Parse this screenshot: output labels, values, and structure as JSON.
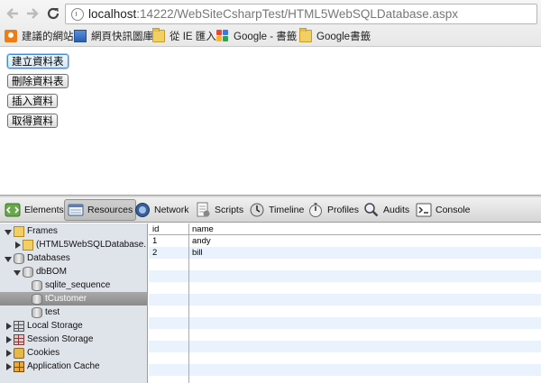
{
  "browser": {
    "url_host": "localhost",
    "url_rest": ":14222/WebSiteCsharpTest/HTML5WebSQLDatabase.aspx",
    "bookmarks": [
      {
        "label": "建議的網站",
        "icon": "suggested-sites-icon"
      },
      {
        "label": "網頁快訊圖庫",
        "icon": "web-slice-gallery-icon"
      },
      {
        "label": "從 IE 匯入",
        "icon": "folder-icon"
      },
      {
        "label": "Google - 書籤",
        "icon": "google-icon"
      },
      {
        "label": "Google書籤",
        "icon": "folder-icon"
      }
    ]
  },
  "page": {
    "buttons": [
      {
        "label": "建立資料表"
      },
      {
        "label": "刪除資料表"
      },
      {
        "label": "插入資料"
      },
      {
        "label": "取得資料"
      }
    ]
  },
  "devtools": {
    "tabs": [
      {
        "label": "Elements",
        "icon": "elements-icon"
      },
      {
        "label": "Resources",
        "icon": "resources-icon"
      },
      {
        "label": "Network",
        "icon": "network-icon"
      },
      {
        "label": "Scripts",
        "icon": "scripts-icon"
      },
      {
        "label": "Timeline",
        "icon": "timeline-icon"
      },
      {
        "label": "Profiles",
        "icon": "profiles-icon"
      },
      {
        "label": "Audits",
        "icon": "audits-icon"
      },
      {
        "label": "Console",
        "icon": "console-icon"
      }
    ],
    "active_tab": "Resources",
    "tree": [
      {
        "label": "Frames",
        "icon": "folder",
        "expand": "down"
      },
      {
        "label": "(HTML5WebSQLDatabase....",
        "icon": "folder",
        "expand": "right"
      },
      {
        "label": "Databases",
        "icon": "db",
        "expand": "down"
      },
      {
        "label": "dbBOM",
        "icon": "db",
        "expand": "down"
      },
      {
        "label": "sqlite_sequence",
        "icon": "db",
        "expand": "none"
      },
      {
        "label": "tCustomer",
        "icon": "db",
        "expand": "none",
        "selected": true
      },
      {
        "label": "test",
        "icon": "db",
        "expand": "none"
      },
      {
        "label": "Local Storage",
        "icon": "grid",
        "expand": "right"
      },
      {
        "label": "Session Storage",
        "icon": "grid-red",
        "expand": "right"
      },
      {
        "label": "Cookies",
        "icon": "cookie",
        "expand": "right"
      },
      {
        "label": "Application Cache",
        "icon": "appcache",
        "expand": "right"
      }
    ],
    "table": {
      "columns": [
        "id",
        "name"
      ],
      "rows": [
        [
          "1",
          "andy"
        ],
        [
          "2",
          "bill"
        ]
      ]
    }
  },
  "colors": {
    "selected_row": "#8a8a8a",
    "grid_alt_row": "#eaf3fd",
    "sidebar_bg": "#dfe4ea"
  }
}
